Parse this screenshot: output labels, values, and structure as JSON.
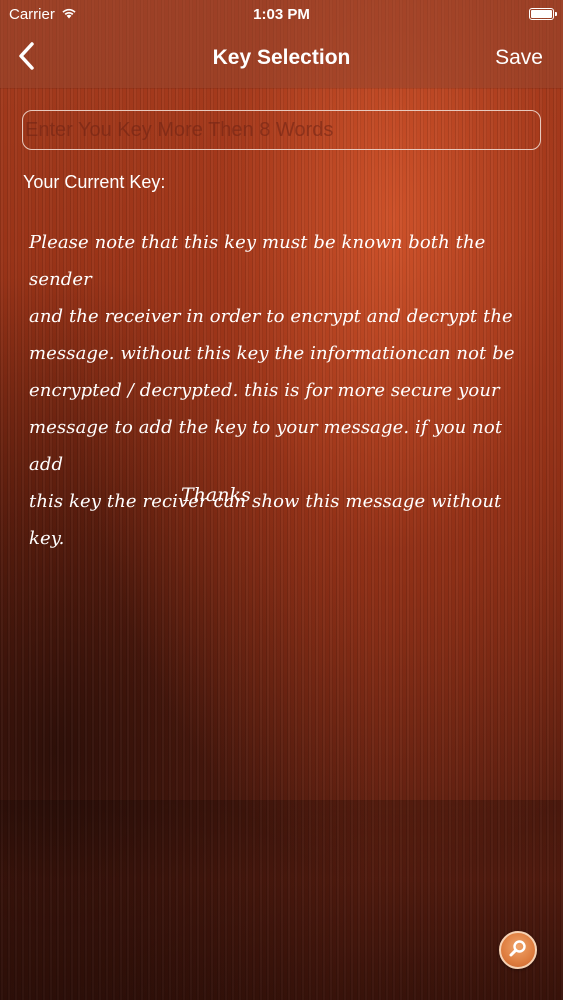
{
  "status_bar": {
    "carrier": "Carrier",
    "time": "1:03 PM",
    "wifi_icon": "wifi-icon",
    "battery_icon": "battery-icon"
  },
  "nav": {
    "title": "Key Selection",
    "back_icon": "chevron-left-icon",
    "save_label": "Save"
  },
  "key_input": {
    "placeholder": "Enter You Key More Then 8 Words",
    "value": ""
  },
  "current_key_label": "Your Current Key:",
  "note": {
    "lines": [
      "Please note that this key must be known both the sender",
      "and the receiver in order to encrypt and decrypt the",
      "message. without this key the informationcan not be",
      "encrypted / decrypted. this is for more secure your",
      "message to add the key to your message. if you not add",
      "this key the reciver can show this message without key."
    ],
    "thanks": "Thanks"
  },
  "fab": {
    "icon": "search-icon"
  },
  "colors": {
    "background_top": "#a53c1e",
    "background_bottom": "#4a180d",
    "fab": "#de7d3f"
  }
}
